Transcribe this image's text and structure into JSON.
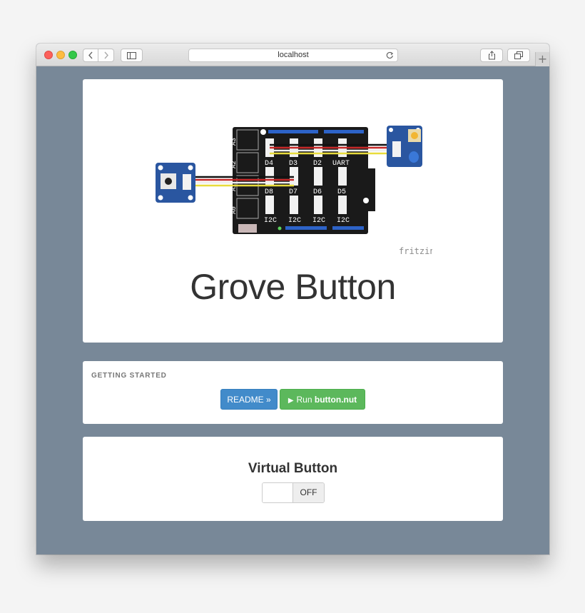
{
  "browser": {
    "address": "localhost",
    "new_tab_glyph": "+",
    "icons": [
      "back-icon",
      "forward-icon",
      "sidebar-icon",
      "reload-icon",
      "share-icon",
      "tabs-icon"
    ]
  },
  "hero": {
    "title": "Grove Button",
    "diagram": {
      "watermark": "fritzing",
      "port_labels": [
        "D4",
        "D3",
        "D2",
        "UART",
        "D8",
        "D7",
        "D6",
        "D5",
        "I2C",
        "I2C",
        "I2C",
        "I2C"
      ],
      "analog_labels": [
        "A3",
        "A2",
        "A1",
        "A0"
      ]
    }
  },
  "getting_started": {
    "heading": "GETTING STARTED",
    "readme_label": "README »",
    "run_prefix": "Run ",
    "run_file": "button.nut"
  },
  "virtual_button": {
    "title": "Virtual Button",
    "state_label": "OFF"
  },
  "colors": {
    "page_background": "#788898",
    "board": "#1a1a1a",
    "grove_module": "#2a56a0",
    "readme_button": "#428bca",
    "run_button": "#5cb85c"
  }
}
